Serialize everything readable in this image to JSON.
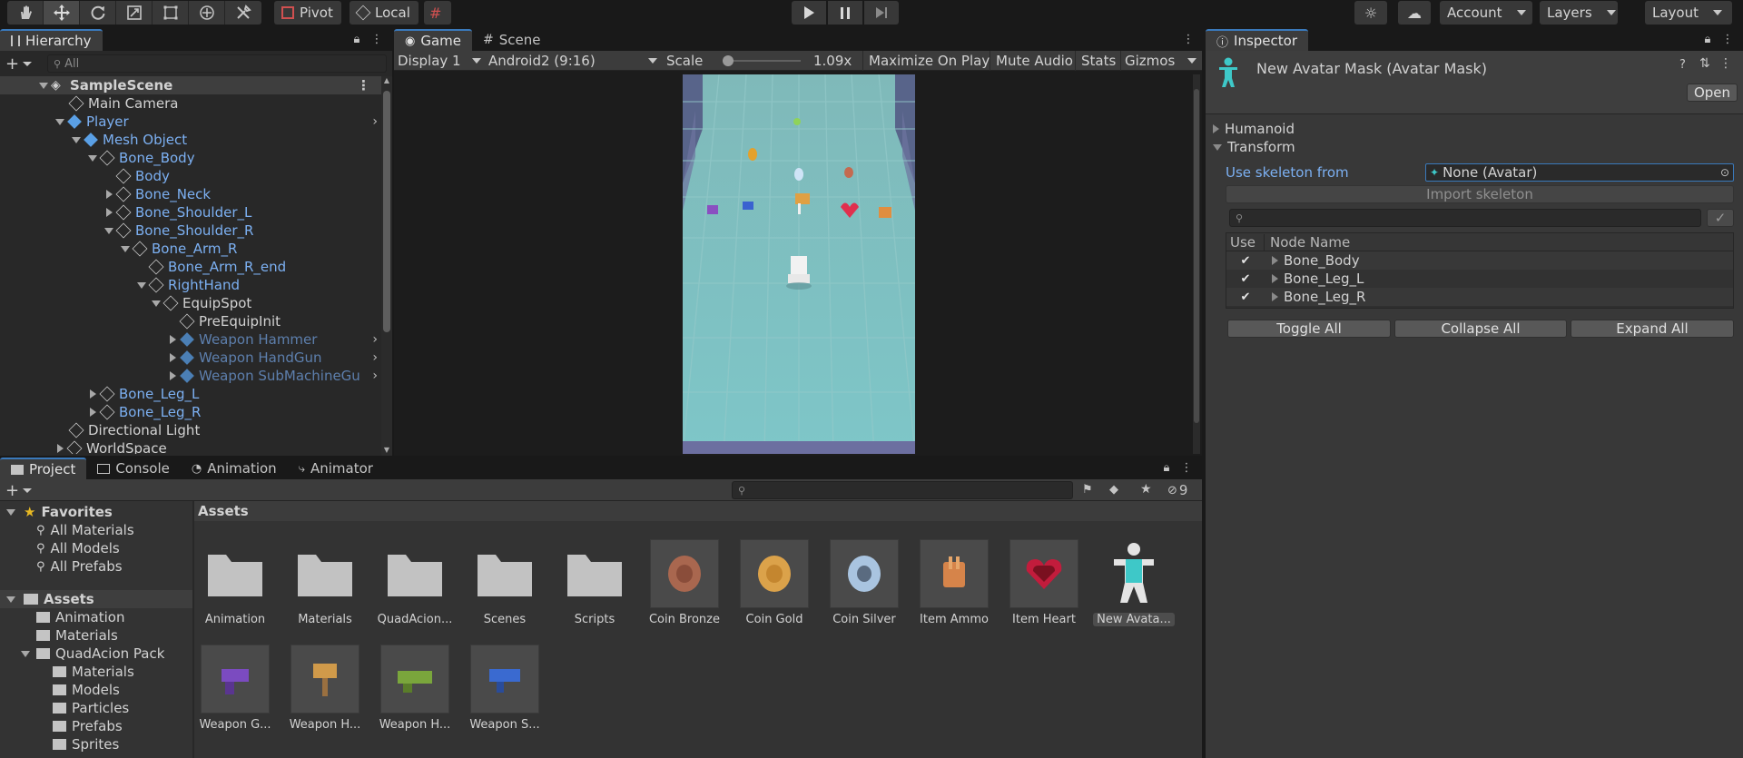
{
  "toolbar": {
    "pivot_label": "Pivot",
    "local_label": "Local",
    "account_label": "Account",
    "layers_label": "Layers",
    "layout_label": "Layout"
  },
  "hierarchy": {
    "tab_label": "Hierarchy",
    "search_placeholder": "All",
    "rows": [
      {
        "label": "SampleScene"
      },
      {
        "label": "Main Camera"
      },
      {
        "label": "Player"
      },
      {
        "label": "Mesh Object"
      },
      {
        "label": "Bone_Body"
      },
      {
        "label": "Body"
      },
      {
        "label": "Bone_Neck"
      },
      {
        "label": "Bone_Shoulder_L"
      },
      {
        "label": "Bone_Shoulder_R"
      },
      {
        "label": "Bone_Arm_R"
      },
      {
        "label": "Bone_Arm_R_end"
      },
      {
        "label": "RightHand"
      },
      {
        "label": "EquipSpot"
      },
      {
        "label": "PreEquipInit"
      },
      {
        "label": "Weapon Hammer"
      },
      {
        "label": "Weapon HandGun"
      },
      {
        "label": "Weapon SubMachineGun"
      },
      {
        "label": "Bone_Leg_L"
      },
      {
        "label": "Bone_Leg_R"
      },
      {
        "label": "Directional Light"
      },
      {
        "label": "WorldSpace"
      }
    ]
  },
  "game_view": {
    "tabs": [
      "Game",
      "Scene"
    ],
    "display": "Display 1",
    "resolution": "Android2 (9:16)",
    "scale_label": "Scale",
    "scale_value": "1.09x",
    "maximize_label": "Maximize On Play",
    "mute_label": "Mute Audio",
    "stats_label": "Stats",
    "gizmos_label": "Gizmos"
  },
  "inspector": {
    "tab_label": "Inspector",
    "title": "New Avatar Mask (Avatar Mask)",
    "open_label": "Open",
    "humanoid_label": "Humanoid",
    "transform_label": "Transform",
    "use_skeleton_label": "Use skeleton from",
    "skeleton_value": "None (Avatar)",
    "import_skeleton_label": "Import skeleton",
    "col_use": "Use",
    "col_node": "Node Name",
    "nodes": [
      "Bone_Body",
      "Bone_Leg_L",
      "Bone_Leg_R"
    ],
    "toggle_all": "Toggle All",
    "collapse_all": "Collapse All",
    "expand_all": "Expand All"
  },
  "project": {
    "tabs": [
      "Project",
      "Console",
      "Animation",
      "Animator"
    ],
    "hidden_count": "9",
    "favorites_label": "Favorites",
    "favorites": [
      "All Materials",
      "All Models",
      "All Prefabs"
    ],
    "assets_root": "Assets",
    "tree": [
      "Animation",
      "Materials",
      "QuadAcion Pack",
      "Materials",
      "Models",
      "Particles",
      "Prefabs",
      "Sprites"
    ],
    "breadcrumb": "Assets",
    "assets": [
      {
        "label": "Animation"
      },
      {
        "label": "Materials"
      },
      {
        "label": "QuadAcion..."
      },
      {
        "label": "Scenes"
      },
      {
        "label": "Scripts"
      },
      {
        "label": "Coin Bronze"
      },
      {
        "label": "Coin Gold"
      },
      {
        "label": "Coin Silver"
      },
      {
        "label": "Item Ammo"
      },
      {
        "label": "Item Heart"
      },
      {
        "label": "New Avata..."
      },
      {
        "label": "Weapon G..."
      },
      {
        "label": "Weapon H..."
      },
      {
        "label": "Weapon H..."
      },
      {
        "label": "Weapon S..."
      }
    ]
  },
  "colors": {
    "accent": "#3a79bb",
    "prefab_text": "#7cb0f2",
    "panel_bg": "#282828",
    "selection": "#2c5d87"
  }
}
